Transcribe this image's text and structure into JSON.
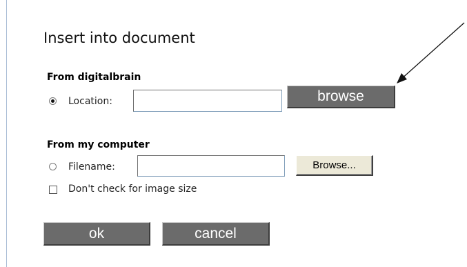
{
  "dialog": {
    "title": "Insert into document"
  },
  "digitalbrain": {
    "heading": "From digitalbrain",
    "radio_label": "Location:",
    "radio_checked": true,
    "input_value": "",
    "browse_label": "browse"
  },
  "computer": {
    "heading": "From my computer",
    "radio_label": "Filename:",
    "radio_checked": false,
    "input_value": "",
    "browse_label": "Browse..."
  },
  "image_size_check": {
    "label": "Don't check for image size",
    "checked": false
  },
  "actions": {
    "ok_label": "ok",
    "cancel_label": "cancel"
  },
  "colors": {
    "button_gray": "#6b6b6b",
    "border_blue": "#a9bdd6"
  }
}
